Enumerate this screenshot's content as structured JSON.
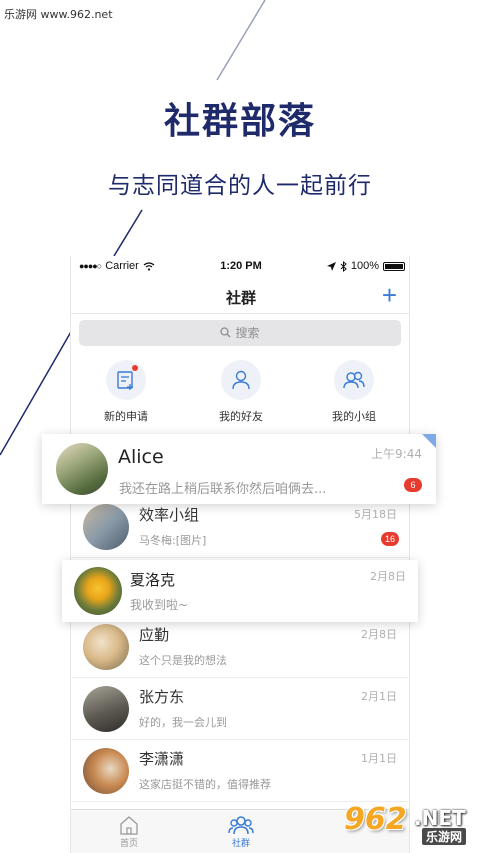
{
  "watermark_top": "乐游网 www.962.net",
  "promo": {
    "title": "社群部落",
    "subtitle": "与志同道合的人一起前行"
  },
  "statusbar": {
    "carrier": "Carrier",
    "time": "1:20 PM",
    "battery": "100%"
  },
  "navbar": {
    "title": "社群",
    "add_icon": "plus-icon"
  },
  "search": {
    "placeholder": "搜索"
  },
  "quick_actions": [
    {
      "label": "新的申请",
      "icon": "new-request-icon"
    },
    {
      "label": "我的好友",
      "icon": "friend-icon"
    },
    {
      "label": "我的小组",
      "icon": "group-icon"
    }
  ],
  "featured_card_1": {
    "name": "Alice",
    "message": "我还在路上稍后联系你然后咱俩去...",
    "time": "上午9:44",
    "badge": "6"
  },
  "featured_card_2": {
    "name": "夏洛克",
    "message": "我收到啦~",
    "time": "2月8日"
  },
  "conversations": [
    {
      "name": "效率小组",
      "message": "马冬梅:[图片]",
      "time": "5月18日",
      "badge": "16"
    },
    {
      "name": "应勤",
      "message": "这个只是我的想法",
      "time": "2月8日"
    },
    {
      "name": "张方东",
      "message": "好的，我一会儿到",
      "time": "2月1日"
    },
    {
      "name": "李潇潇",
      "message": "这家店挺不错的，值得推荐",
      "time": "1月1日"
    }
  ],
  "tabbar": {
    "home": "首页",
    "community": "社群"
  },
  "colors": {
    "brand_navy": "#1f2a6b",
    "accent_blue": "#3a7bd5",
    "badge_red": "#e63b2e"
  },
  "watermark_bottom": {
    "number": "962",
    "net": ".NET",
    "cn": "乐游网"
  }
}
